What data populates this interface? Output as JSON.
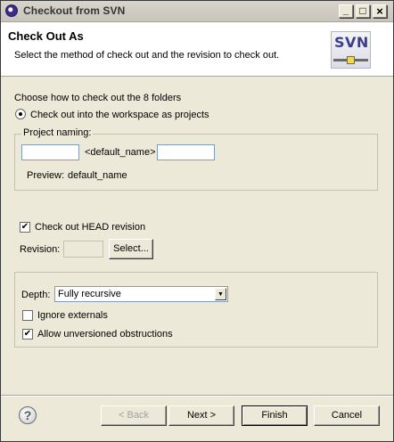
{
  "window": {
    "title": "Checkout from SVN",
    "controls": {
      "minimize": "_",
      "maximize": "□",
      "close": "×"
    }
  },
  "header": {
    "title": "Check Out As",
    "description": "Select the method of check out and the revision to check out.",
    "logo_text": "SVN"
  },
  "checkout_method": {
    "heading": "Choose how to check out the 8 folders",
    "option_label": "Check out into the workspace as projects",
    "option_selected": true
  },
  "project_naming": {
    "group_label": "Project naming:",
    "prefix_value": "",
    "middle_text": "<default_name>",
    "suffix_value": "",
    "preview_label": "Preview:",
    "preview_value": "default_name"
  },
  "revision": {
    "head_label": "Check out HEAD revision",
    "head_checked": true,
    "revision_label": "Revision:",
    "revision_value": "",
    "select_button": "Select..."
  },
  "depth": {
    "label": "Depth:",
    "selected": "Fully recursive",
    "ignore_externals_label": "Ignore externals",
    "ignore_externals_checked": false,
    "allow_unversioned_label": "Allow unversioned obstructions",
    "allow_unversioned_checked": true
  },
  "buttons": {
    "back": "< Back",
    "next": "Next >",
    "finish": "Finish",
    "cancel": "Cancel"
  },
  "help": {
    "icon_glyph": "?"
  },
  "colors": {
    "dialog_bg": "#ece9d8",
    "header_bg": "#ffffff",
    "logo_text": "#3b3e8c"
  }
}
